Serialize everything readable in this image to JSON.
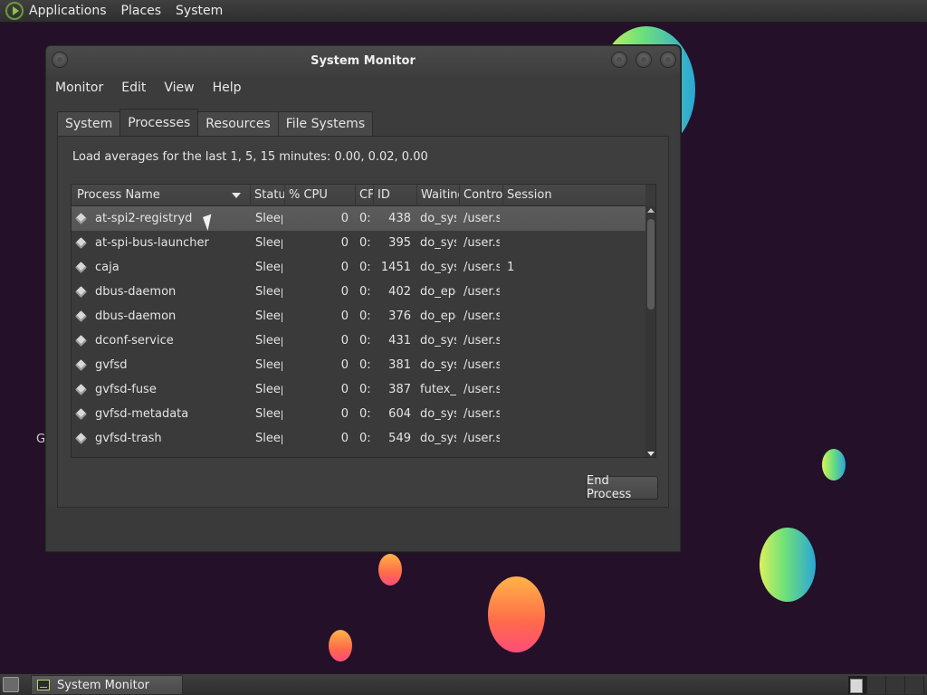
{
  "top_panel": {
    "menus": [
      "Applications",
      "Places",
      "System"
    ]
  },
  "desktop": {
    "icon_label_fragment": "G"
  },
  "window": {
    "title": "System Monitor",
    "menus": [
      "Monitor",
      "Edit",
      "View",
      "Help"
    ],
    "tabs": [
      {
        "label": "System",
        "active": false
      },
      {
        "label": "Processes",
        "active": true
      },
      {
        "label": "Resources",
        "active": false
      },
      {
        "label": "File Systems",
        "active": false
      }
    ],
    "load_averages": "Load averages for the last 1, 5, 15 minutes: 0.00, 0.02, 0.00",
    "table": {
      "columns": [
        "Process Name",
        "Statu",
        "% CPU",
        "CF",
        "ID",
        "Waiting",
        "Contro",
        "Session"
      ],
      "rows": [
        {
          "name": "at-spi2-registryd",
          "status": "Sleeping",
          "cpu": "0",
          "cputime": "0:",
          "id": "438",
          "waiting": "do_sys",
          "control": "/user.s",
          "session": "",
          "selected": true
        },
        {
          "name": "at-spi-bus-launcher",
          "status": "Sleeping",
          "cpu": "0",
          "cputime": "0:",
          "id": "395",
          "waiting": "do_sys",
          "control": "/user.s",
          "session": ""
        },
        {
          "name": "caja",
          "status": "Sleeping",
          "cpu": "0",
          "cputime": "0:",
          "id": "1451",
          "waiting": "do_sys",
          "control": "/user.s",
          "session": "1"
        },
        {
          "name": "dbus-daemon",
          "status": "Sleeping",
          "cpu": "0",
          "cputime": "0:",
          "id": "402",
          "waiting": "do_epoll",
          "control": "/user.s",
          "session": ""
        },
        {
          "name": "dbus-daemon",
          "status": "Sleeping",
          "cpu": "0",
          "cputime": "0:",
          "id": "376",
          "waiting": "do_epoll",
          "control": "/user.s",
          "session": ""
        },
        {
          "name": "dconf-service",
          "status": "Sleeping",
          "cpu": "0",
          "cputime": "0:",
          "id": "431",
          "waiting": "do_sys",
          "control": "/user.s",
          "session": ""
        },
        {
          "name": "gvfsd",
          "status": "Sleeping",
          "cpu": "0",
          "cputime": "0:",
          "id": "381",
          "waiting": "do_sys",
          "control": "/user.s",
          "session": ""
        },
        {
          "name": "gvfsd-fuse",
          "status": "Sleeping",
          "cpu": "0",
          "cputime": "0:",
          "id": "387",
          "waiting": "futex_w",
          "control": "/user.s",
          "session": ""
        },
        {
          "name": "gvfsd-metadata",
          "status": "Sleeping",
          "cpu": "0",
          "cputime": "0:",
          "id": "604",
          "waiting": "do_sys",
          "control": "/user.s",
          "session": ""
        },
        {
          "name": "gvfsd-trash",
          "status": "Sleeping",
          "cpu": "0",
          "cputime": "0:",
          "id": "549",
          "waiting": "do_sys",
          "control": "/user.s",
          "session": ""
        }
      ]
    },
    "end_process_label": "End Process"
  },
  "taskbar": {
    "task_label": "System Monitor"
  },
  "colors": {
    "desktop_bg": "#25102a",
    "window_bg": "#3c3c3c",
    "selected_row": "#5a5a5a"
  }
}
